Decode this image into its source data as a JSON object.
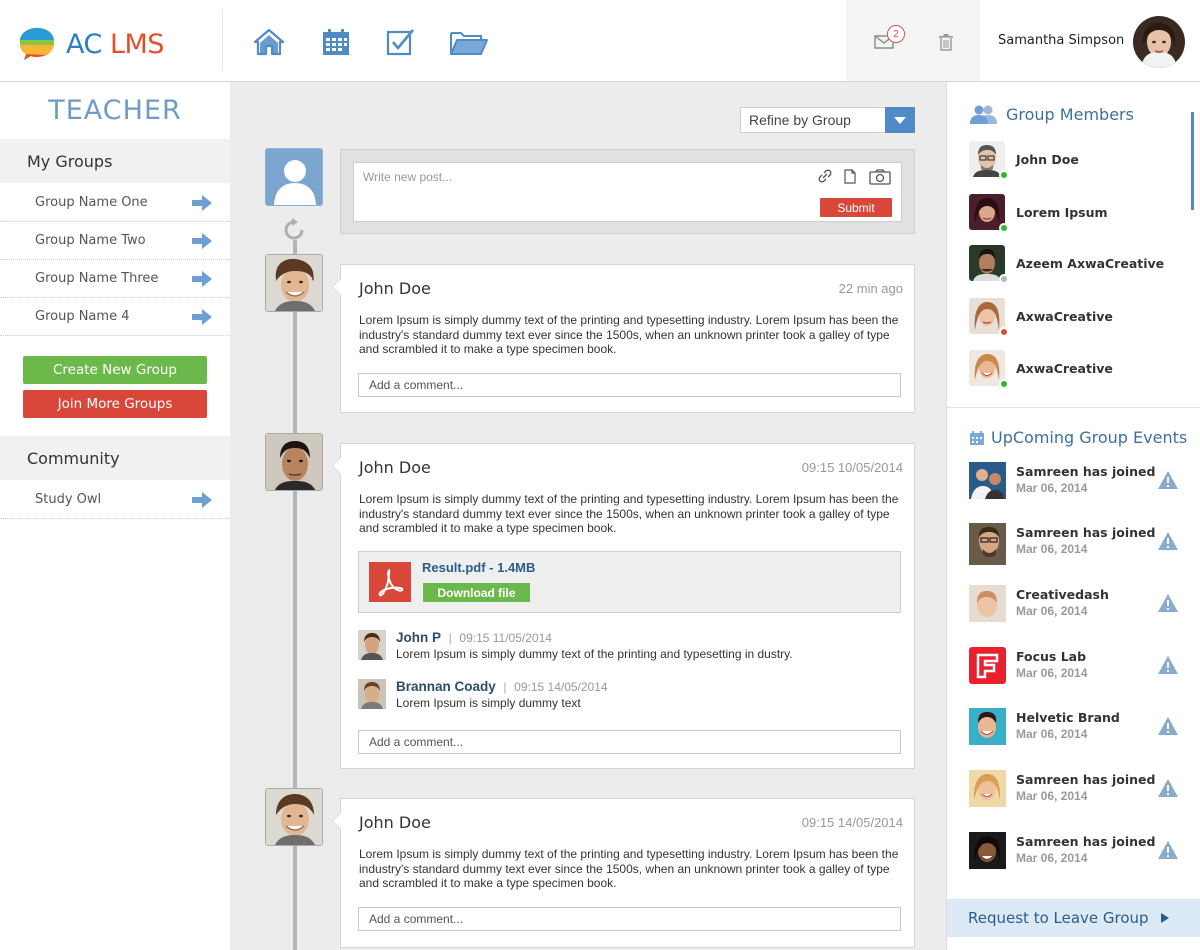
{
  "header": {
    "logo_text_a": "AC",
    "logo_text_b": "LMS",
    "nav": [
      "home-icon",
      "calendar-icon",
      "checkbox-icon",
      "folder-icon"
    ],
    "mail_count": "2",
    "user_name": "Samantha Simpson"
  },
  "sidebar": {
    "role": "TEACHER",
    "my_groups_title": "My Groups",
    "groups": [
      "Group Name One",
      "Group Name Two",
      "Group Name Three",
      "Group Name 4"
    ],
    "create_btn": "Create New Group",
    "join_btn": "Join More Groups",
    "community_title": "Community",
    "community": [
      "Study Owl"
    ]
  },
  "feed": {
    "refine_label": "Refine by Group",
    "compose_placeholder": "Write new post...",
    "submit_label": "Submit",
    "comment_placeholder": "Add a comment...",
    "posts": [
      {
        "author": "John Doe",
        "time": "22 min ago",
        "body": "Lorem Ipsum is simply dummy text of the printing and typesetting industry. Lorem Ipsum has been the industry's standard dummy text ever since the 1500s, when an unknown printer took a galley of type and scrambled it to make a type specimen book."
      },
      {
        "author": "John Doe",
        "time": "09:15  10/05/2014",
        "body": "Lorem Ipsum is simply dummy text of the printing and typesetting industry. Lorem Ipsum has been the industry's standard dummy text ever since the 1500s, when an unknown printer took a galley of type and scrambled it to make a type specimen book.",
        "attachment": {
          "name": "Result.pdf - 1.4MB",
          "download": "Download file"
        },
        "replies": [
          {
            "author": "John P",
            "time": "09:15  11/05/2014",
            "text": "Lorem Ipsum is simply dummy text of the printing and typesetting in dustry."
          },
          {
            "author": "Brannan Coady",
            "time": "09:15  14/05/2014",
            "text": "Lorem Ipsum is simply dummy text"
          }
        ]
      },
      {
        "author": "John Doe",
        "time": "09:15  14/05/2014",
        "body": "Lorem Ipsum is simply dummy text of the printing and typesetting industry. Lorem Ipsum has been the industry's standard dummy text ever since the 1500s, when an unknown printer took a galley of type and scrambled it to make a type specimen book."
      }
    ]
  },
  "right": {
    "members_title": "Group Members",
    "members": [
      {
        "name": "John Doe",
        "status": "#2db92d"
      },
      {
        "name": "Lorem Ipsum",
        "status": "#2db92d"
      },
      {
        "name": "Azeem AxwaCreative",
        "status": "#b5b5b5"
      },
      {
        "name": "AxwaCreative",
        "status": "#e2492f"
      },
      {
        "name": "AxwaCreative",
        "status": "#2db92d"
      }
    ],
    "events_title": "UpComing Group Events",
    "events": [
      {
        "name": "Samreen has joined",
        "date": "Mar 06, 2014"
      },
      {
        "name": "Samreen has joined",
        "date": "Mar 06, 2014"
      },
      {
        "name": "Creativedash",
        "date": "Mar 06, 2014"
      },
      {
        "name": "Focus Lab",
        "date": "Mar 06, 2014"
      },
      {
        "name": "Helvetic Brand",
        "date": "Mar 06, 2014"
      },
      {
        "name": "Samreen has joined",
        "date": "Mar 06, 2014"
      },
      {
        "name": "Samreen has joined",
        "date": "Mar 06, 2014"
      }
    ],
    "leave_label": "Request to Leave Group"
  },
  "colors": {
    "accent_blue": "#4f8bc7",
    "green": "#6cb94b",
    "red": "#d9473b"
  }
}
